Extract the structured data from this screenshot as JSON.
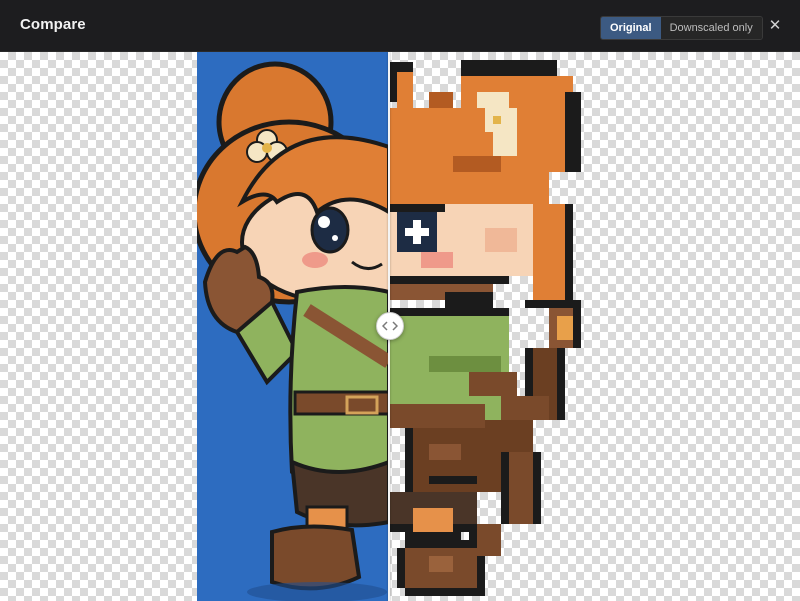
{
  "window": {
    "title": "Compare"
  },
  "toolbar": {
    "modes": [
      {
        "label": "Original",
        "active": true
      },
      {
        "label": "Downscaled only",
        "active": false
      }
    ],
    "close_icon": "close-icon",
    "close_glyph": "✕"
  },
  "viewer": {
    "background": "transparency-checkerboard",
    "original_backdrop_color": "#2d6cc0",
    "handle_icon": "chevrons-left-right-icon"
  }
}
